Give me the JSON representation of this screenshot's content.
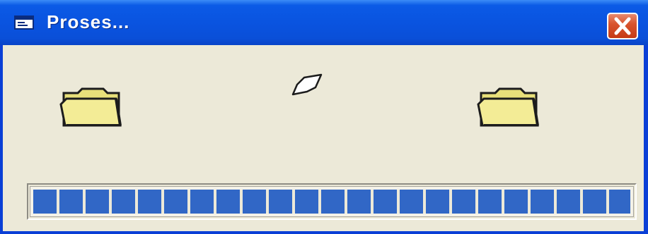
{
  "window": {
    "title": "Proses...",
    "icon": "window-app-icon",
    "close_icon": "close-icon"
  },
  "animation": {
    "source_icon": "folder-open-icon",
    "document_icon": "flying-paper-icon",
    "destination_icon": "folder-open-icon"
  },
  "progress": {
    "value": 1.0,
    "block_color": "#3167c6"
  },
  "colors": {
    "titlebar": "#0a53df",
    "face": "#ece9d8",
    "close_button": "#d9552f"
  }
}
